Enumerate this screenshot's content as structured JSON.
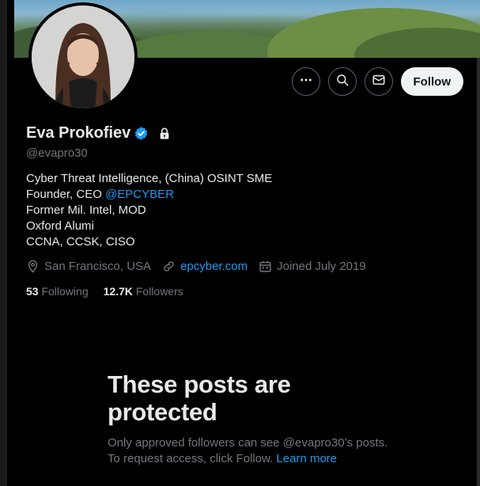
{
  "profile": {
    "name": "Eva Prokofiev",
    "handle": "@evapro30",
    "bio_line1": "Cyber Threat Intelligence, (China) OSINT SME",
    "bio_line2_prefix": "Founder, CEO ",
    "bio_line2_mention": "@EPCYBER",
    "bio_line3": "Former Mil. Intel, MOD",
    "bio_line4": "Oxford Alumi",
    "bio_line5": "CCNA, CCSK, CISO",
    "location": "San Francisco, USA",
    "website": "epcyber.com",
    "joined": "Joined July 2019",
    "following_count": "53",
    "following_label": "Following",
    "followers_count": "12.7K",
    "followers_label": "Followers"
  },
  "actions": {
    "more_icon": "more-icon",
    "search_icon": "search-icon",
    "message_icon": "envelope-icon",
    "follow_label": "Follow"
  },
  "protected": {
    "title": "These posts are protected",
    "body_text": "Only approved followers can see @evapro30’s posts. To request access, click Follow. ",
    "learn_more": "Learn more"
  },
  "colors": {
    "background": "#000000",
    "accent": "#1d9bf0",
    "muted": "#71767b",
    "text": "#e7e9ea"
  }
}
